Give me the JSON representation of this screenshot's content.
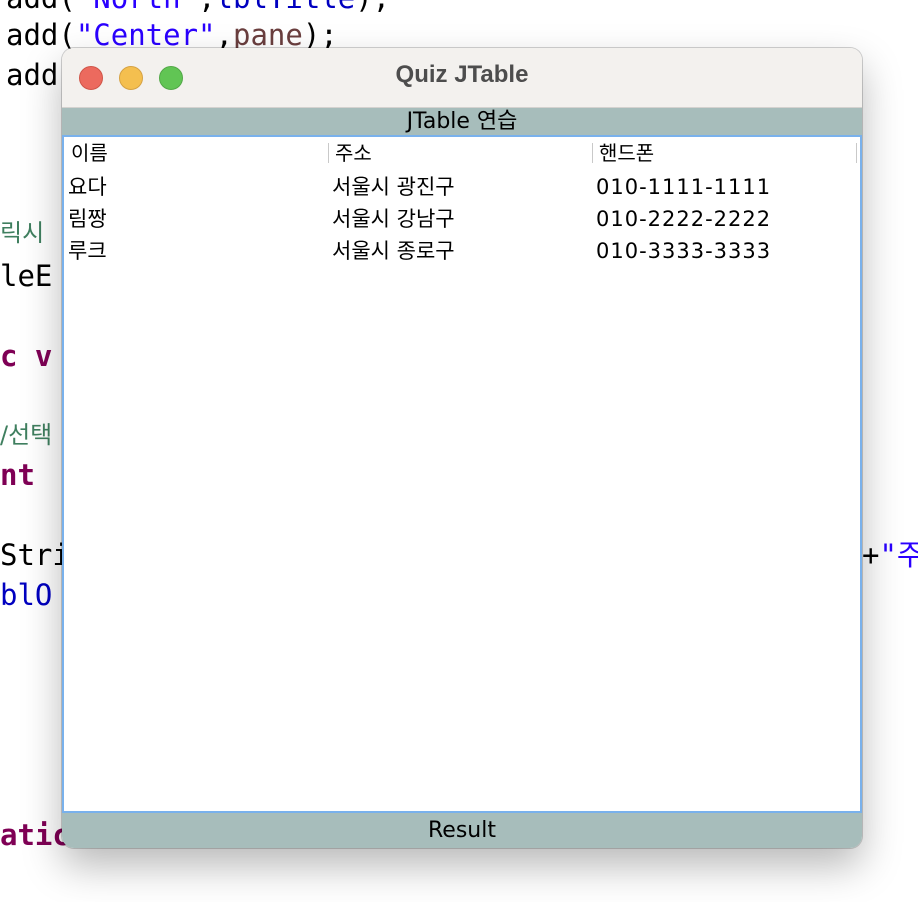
{
  "background_code": [
    {
      "segments": [
        {
          "text": "add(",
          "cls": "c-plain"
        },
        {
          "text": "\"North\"",
          "cls": "c-string"
        },
        {
          "text": ",",
          "cls": "c-plain"
        },
        {
          "text": "lblTitle",
          "cls": "c-field"
        },
        {
          "text": ");",
          "cls": "c-plain"
        }
      ]
    },
    {
      "segments": [
        {
          "text": "add(",
          "cls": "c-plain"
        },
        {
          "text": "\"Center\"",
          "cls": "c-string"
        },
        {
          "text": ",",
          "cls": "c-plain"
        },
        {
          "text": "pane",
          "cls": "c-var"
        },
        {
          "text": ");",
          "cls": "c-plain"
        }
      ]
    },
    {
      "segments": [
        {
          "text": "add",
          "cls": "c-plain"
        }
      ]
    },
    {
      "segments": [
        {
          "text": "릭시",
          "cls": "c-comment"
        }
      ]
    },
    {
      "segments": [
        {
          "text": "leE",
          "cls": "c-plain"
        }
      ]
    },
    {
      "segments": [
        {
          "text": "c v",
          "cls": "c-kw"
        }
      ]
    },
    {
      "segments": [
        {
          "text": "/선택",
          "cls": "c-comment"
        }
      ]
    },
    {
      "segments": [
        {
          "text": "nt",
          "cls": "c-kw"
        }
      ]
    },
    {
      "segments": [
        {
          "text": "Stri",
          "cls": "c-plain"
        }
      ]
    },
    {
      "segments": [
        {
          "text": "+",
          "cls": "c-plain"
        },
        {
          "text": "\"주",
          "cls": "c-string"
        }
      ]
    },
    {
      "segments": [
        {
          "text": "blO",
          "cls": "c-field"
        }
      ]
    },
    {
      "segments": [
        {
          "text": "atic",
          "cls": "c-kw"
        }
      ]
    }
  ],
  "window": {
    "title": "Quiz JTable",
    "panel_title": "JTable 연습",
    "status_label": "Result"
  },
  "table": {
    "columns": [
      "이름",
      "주소",
      "핸드폰"
    ],
    "rows": [
      [
        "요다",
        "서울시 광진구",
        "010-1111-1111"
      ],
      [
        "림짱",
        "서울시 강남구",
        "010-2222-2222"
      ],
      [
        "루크",
        "서울시 종로구",
        "010-3333-3333"
      ]
    ]
  },
  "colors": {
    "panel_bar": "#a7bdbb",
    "table_border": "#79b1ec",
    "close_light": "#ec6a5e",
    "minimize_light": "#f4bf4f",
    "maximize_light": "#61c554"
  }
}
